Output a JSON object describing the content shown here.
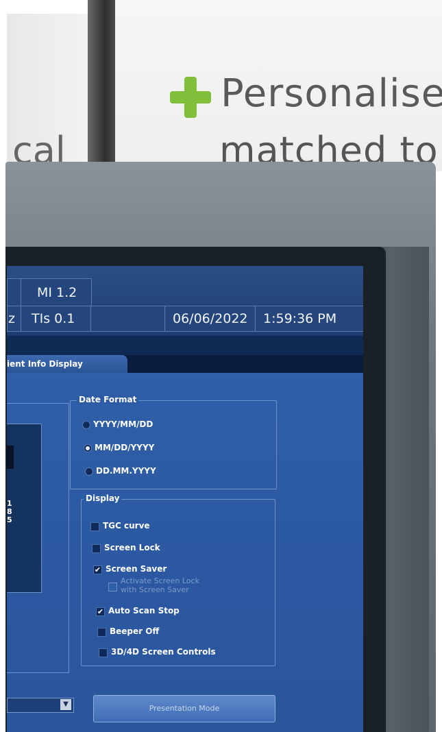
{
  "background": {
    "poster_line1": "Personalise",
    "poster_line2": "matched to",
    "left_fragment": "cal",
    "accent": "#7fbf3a"
  },
  "statusbar": {
    "mi": "MI 1.2",
    "tis_prefix": "z",
    "tis": "TIs 0.1",
    "date": "06/06/2022",
    "time": "1:59:36 PM"
  },
  "tab": {
    "label": "ient Info Display"
  },
  "date_format": {
    "legend": "Date Format",
    "options": [
      {
        "label": "YYYY/MM/DD",
        "selected": false
      },
      {
        "label": "MM/DD/YYYY",
        "selected": true
      },
      {
        "label": "DD.MM.YYYY",
        "selected": false
      }
    ]
  },
  "display": {
    "legend": "Display",
    "items": [
      {
        "label": "TGC curve",
        "checked": false,
        "enabled": true
      },
      {
        "label": "Screen Lock",
        "checked": false,
        "enabled": true
      },
      {
        "label": "Screen Saver",
        "checked": true,
        "enabled": true
      },
      {
        "label_line1": "Activate Screen Lock",
        "label_line2": "with Screen Saver",
        "checked": false,
        "enabled": false
      },
      {
        "label": "Auto Scan Stop",
        "checked": true,
        "enabled": true
      },
      {
        "label": "Beeper Off",
        "checked": false,
        "enabled": true
      },
      {
        "label": "3D/4D Screen Controls",
        "checked": false,
        "enabled": true
      }
    ]
  },
  "left_partial": {
    "n1": "1",
    "n2": "8",
    "n3": "5"
  },
  "buttons": {
    "presentation_mode": "Presentation Mode"
  },
  "colors": {
    "screen_bg": "#2b58a0",
    "topbar": "#1d3d70"
  }
}
